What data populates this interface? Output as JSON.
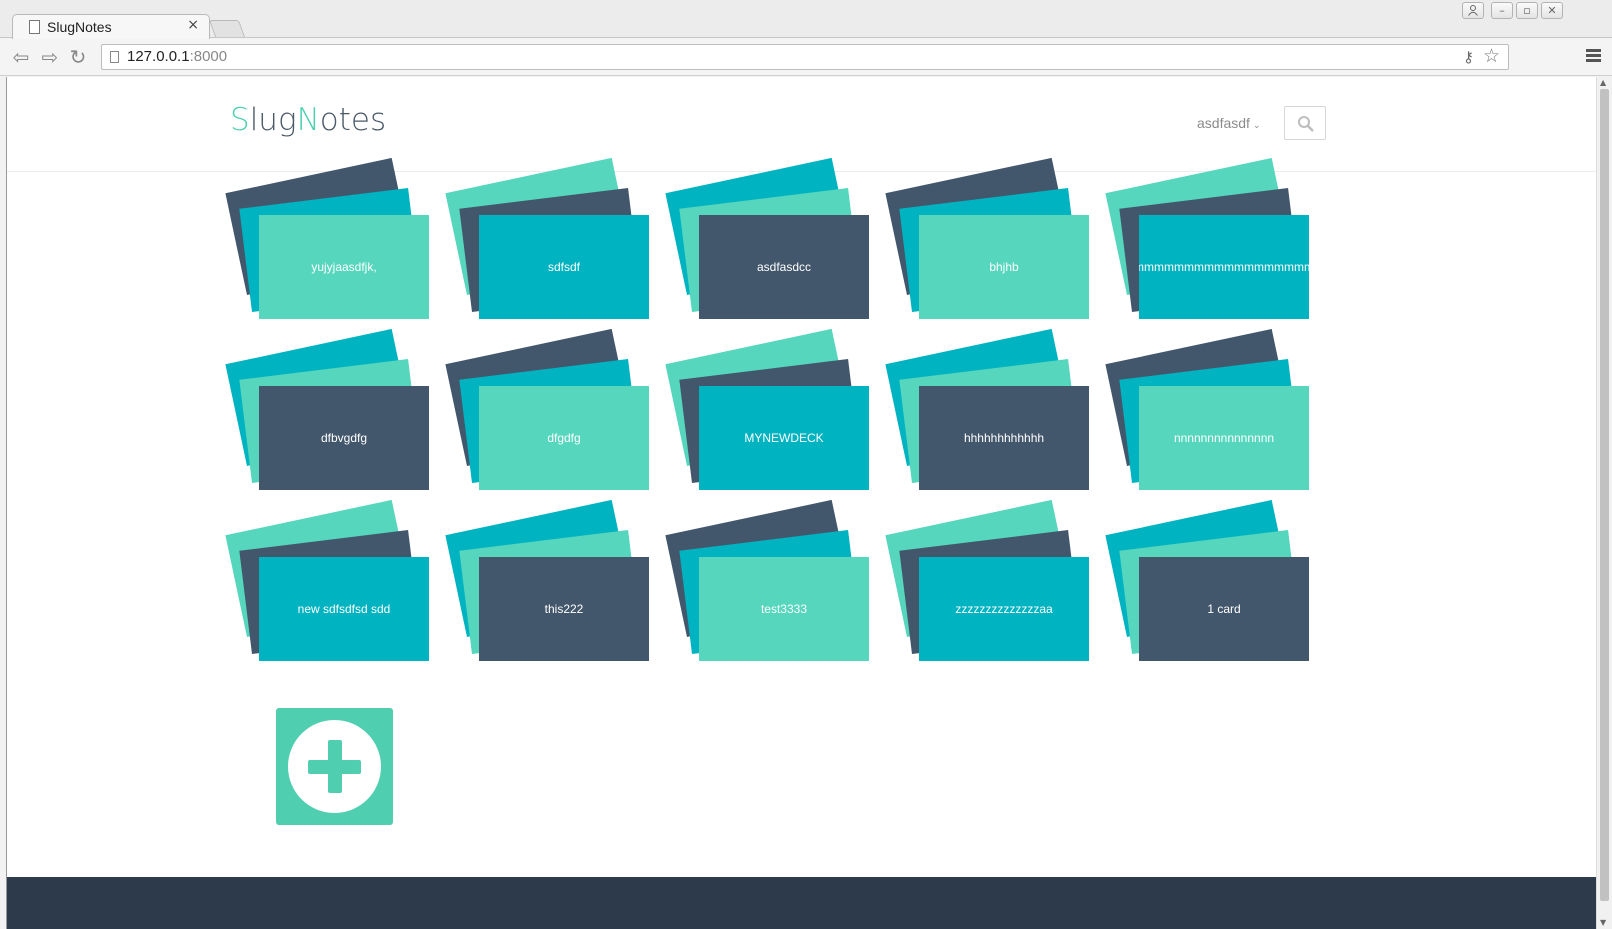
{
  "browser": {
    "tab_title": "SlugNotes",
    "tab_close": "×",
    "url_host": "127.0.0.1",
    "url_port": ":8000"
  },
  "site": {
    "logo_s": "S",
    "logo_lug": "lug",
    "logo_n": "N",
    "logo_otes": "otes",
    "username": "asdfasdf"
  },
  "decks": [
    {
      "label": "yujyjaasdfjk,",
      "colors": [
        "c-dark",
        "c-teal",
        "c-mint"
      ]
    },
    {
      "label": "sdfsdf",
      "colors": [
        "c-mint",
        "c-dark",
        "c-teal"
      ]
    },
    {
      "label": "asdfasdcc",
      "colors": [
        "c-teal",
        "c-mint",
        "c-dark"
      ]
    },
    {
      "label": "bhjhb",
      "colors": [
        "c-dark",
        "c-teal",
        "c-mint"
      ]
    },
    {
      "label": "mmmmmmmmmmmmmmmmmmmm",
      "colors": [
        "c-mint",
        "c-dark",
        "c-teal"
      ]
    },
    {
      "label": "dfbvgdfg",
      "colors": [
        "c-teal",
        "c-mint",
        "c-dark"
      ]
    },
    {
      "label": "dfgdfg",
      "colors": [
        "c-dark",
        "c-teal",
        "c-mint"
      ]
    },
    {
      "label": "MYNEWDECK",
      "colors": [
        "c-mint",
        "c-dark",
        "c-teal"
      ]
    },
    {
      "label": "hhhhhhhhhhhh",
      "colors": [
        "c-teal",
        "c-mint",
        "c-dark"
      ]
    },
    {
      "label": "nnnnnnnnnnnnnnn",
      "colors": [
        "c-dark",
        "c-teal",
        "c-mint"
      ]
    },
    {
      "label": "new sdfsdfsd sdd",
      "colors": [
        "c-mint",
        "c-dark",
        "c-teal"
      ]
    },
    {
      "label": "this222",
      "colors": [
        "c-teal",
        "c-mint",
        "c-dark"
      ]
    },
    {
      "label": "test3333",
      "colors": [
        "c-dark",
        "c-teal",
        "c-mint"
      ]
    },
    {
      "label": "zzzzzzzzzzzzzzaa",
      "colors": [
        "c-mint",
        "c-dark",
        "c-teal"
      ]
    },
    {
      "label": "1 card",
      "colors": [
        "c-teal",
        "c-mint",
        "c-dark"
      ]
    }
  ],
  "colors": {
    "dark": "#43576c",
    "teal": "#00b3c1",
    "mint": "#55d6bd",
    "footer": "#2c3a4b"
  }
}
